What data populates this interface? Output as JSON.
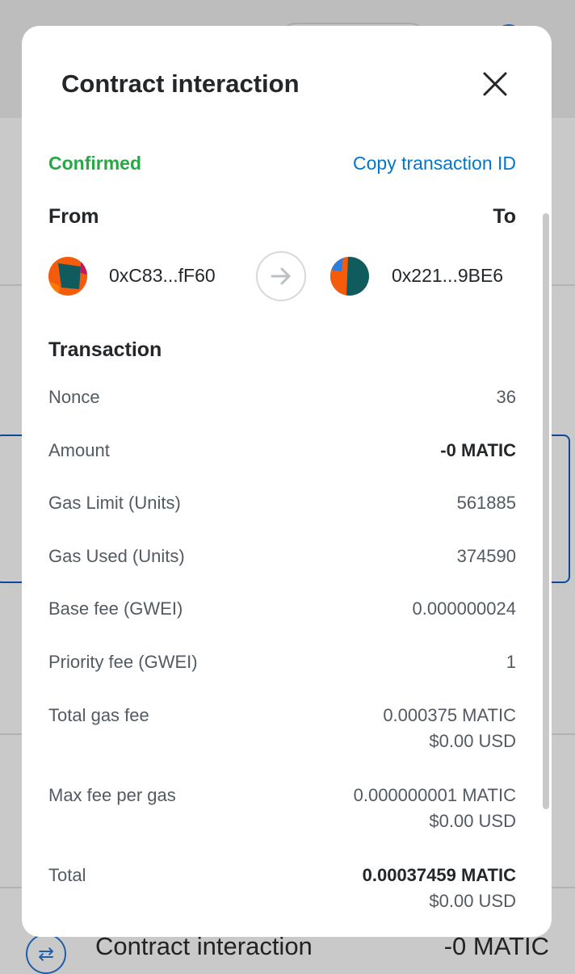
{
  "background": {
    "bottom_row": {
      "title": "Contract interaction",
      "amount": "-0 MATIC"
    }
  },
  "modal": {
    "title": "Contract interaction",
    "status": "Confirmed",
    "copy_link": "Copy transaction ID",
    "from_label": "From",
    "to_label": "To",
    "from_address": "0xC83...fF60",
    "to_address": "0x221...9BE6",
    "section_title": "Transaction",
    "details": {
      "nonce": {
        "label": "Nonce",
        "value": "36"
      },
      "amount": {
        "label": "Amount",
        "value": "-0 MATIC"
      },
      "gas_limit": {
        "label": "Gas Limit (Units)",
        "value": "561885"
      },
      "gas_used": {
        "label": "Gas Used (Units)",
        "value": "374590"
      },
      "base_fee": {
        "label": "Base fee (GWEI)",
        "value": "0.000000024"
      },
      "priority_fee": {
        "label": "Priority fee (GWEI)",
        "value": "1"
      },
      "total_gas_fee": {
        "label": "Total gas fee",
        "value": "0.000375 MATIC",
        "fiat": "$0.00 USD"
      },
      "max_fee_per_gas": {
        "label": "Max fee per gas",
        "value": "0.000000001 MATIC",
        "fiat": "$0.00 USD"
      },
      "total": {
        "label": "Total",
        "value": "0.00037459 MATIC",
        "fiat": "$0.00 USD"
      }
    }
  },
  "colors": {
    "status_green": "#28a745",
    "link_blue": "#0376c9",
    "text_primary": "#24272a",
    "text_secondary": "#535a61"
  }
}
